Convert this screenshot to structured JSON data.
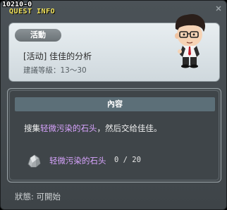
{
  "window": {
    "quest_id": "10210-0",
    "title": "QUEST INFO"
  },
  "header": {
    "category": "活動",
    "quest_name": "[活动] 佳佳的分析",
    "level_label": "建議等級：13～30"
  },
  "contents": {
    "section_title": "內容",
    "description_pre": "搜集",
    "description_highlight": "轻微污染的石头",
    "description_post": "，然后交给佳佳。",
    "requirements": [
      {
        "icon": "stone-icon",
        "item_name": "轻微污染的石头",
        "progress": "0 / 20",
        "current": 0,
        "required": 20
      }
    ]
  },
  "footer": {
    "status": "狀態: 可開始"
  },
  "colors": {
    "title_yellow": "#f2e35b",
    "highlight_purple": "#d9a4ff",
    "section_header": "#5c6f78"
  }
}
